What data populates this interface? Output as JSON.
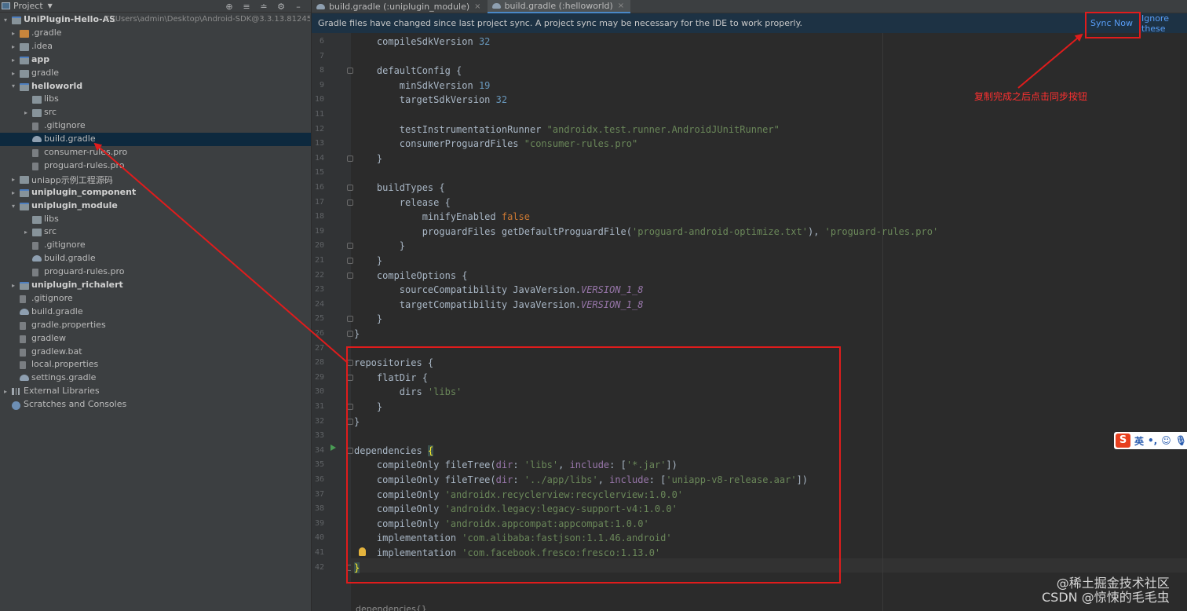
{
  "project_panel": {
    "title": "Project",
    "tree": [
      {
        "label": "UniPlugin-Hello-AS",
        "path": "C:\\Users\\admin\\Desktop\\Android-SDK@3.3.13.81245",
        "type": "module",
        "bold": true,
        "arrow": "▾",
        "level": 0
      },
      {
        "label": ".gradle",
        "type": "folder-orange",
        "arrow": "▸",
        "level": 1
      },
      {
        "label": ".idea",
        "type": "folder",
        "arrow": "▸",
        "level": 1
      },
      {
        "label": "app",
        "type": "module",
        "bold": true,
        "arrow": "▸",
        "level": 1
      },
      {
        "label": "gradle",
        "type": "folder",
        "arrow": "▸",
        "level": 1
      },
      {
        "label": "helloworld",
        "type": "module",
        "bold": true,
        "arrow": "▾",
        "level": 1
      },
      {
        "label": "libs",
        "type": "folder",
        "arrow": "",
        "level": 2
      },
      {
        "label": "src",
        "type": "folder",
        "arrow": "▸",
        "level": 2
      },
      {
        "label": ".gitignore",
        "type": "file",
        "arrow": "",
        "level": 2
      },
      {
        "label": "build.gradle",
        "type": "gradle",
        "arrow": "",
        "level": 2,
        "selected": true
      },
      {
        "label": "consumer-rules.pro",
        "type": "file",
        "arrow": "",
        "level": 2
      },
      {
        "label": "proguard-rules.pro",
        "type": "file",
        "arrow": "",
        "level": 2
      },
      {
        "label": "uniapp示例工程源码",
        "type": "folder",
        "arrow": "▸",
        "level": 1
      },
      {
        "label": "uniplugin_component",
        "type": "module",
        "bold": true,
        "arrow": "▸",
        "level": 1
      },
      {
        "label": "uniplugin_module",
        "type": "module",
        "bold": true,
        "arrow": "▾",
        "level": 1
      },
      {
        "label": "libs",
        "type": "folder",
        "arrow": "",
        "level": 2
      },
      {
        "label": "src",
        "type": "folder",
        "arrow": "▸",
        "level": 2
      },
      {
        "label": ".gitignore",
        "type": "file",
        "arrow": "",
        "level": 2
      },
      {
        "label": "build.gradle",
        "type": "gradle",
        "arrow": "",
        "level": 2
      },
      {
        "label": "proguard-rules.pro",
        "type": "file",
        "arrow": "",
        "level": 2
      },
      {
        "label": "uniplugin_richalert",
        "type": "module",
        "bold": true,
        "arrow": "▸",
        "level": 1
      },
      {
        "label": ".gitignore",
        "type": "file",
        "arrow": "",
        "level": 1
      },
      {
        "label": "build.gradle",
        "type": "gradle",
        "arrow": "",
        "level": 1
      },
      {
        "label": "gradle.properties",
        "type": "file",
        "arrow": "",
        "level": 1
      },
      {
        "label": "gradlew",
        "type": "file",
        "arrow": "",
        "level": 1
      },
      {
        "label": "gradlew.bat",
        "type": "file",
        "arrow": "",
        "level": 1
      },
      {
        "label": "local.properties",
        "type": "file",
        "arrow": "",
        "level": 1
      },
      {
        "label": "settings.gradle",
        "type": "gradle",
        "arrow": "",
        "level": 1
      },
      {
        "label": "External Libraries",
        "type": "lib",
        "arrow": "▸",
        "level": 0
      },
      {
        "label": "Scratches and Consoles",
        "type": "scratch",
        "arrow": "",
        "level": 0
      }
    ]
  },
  "tabs": [
    {
      "label": "build.gradle (:uniplugin_module)",
      "active": false
    },
    {
      "label": "build.gradle (:helloworld)",
      "active": true
    }
  ],
  "banner": {
    "message": "Gradle files have changed since last project sync. A project sync may be necessary for the IDE to work properly.",
    "sync_now": "Sync Now",
    "ignore": "Ignore these"
  },
  "editor": {
    "lines": [
      {
        "n": 6,
        "html": "    compileSdkVersion <span class=\"num\">32</span>"
      },
      {
        "n": 7,
        "html": ""
      },
      {
        "n": 8,
        "html": "    defaultConfig {",
        "fold": true
      },
      {
        "n": 9,
        "html": "        minSdkVersion <span class=\"num\">19</span>"
      },
      {
        "n": 10,
        "html": "        targetSdkVersion <span class=\"num\">32</span>"
      },
      {
        "n": 11,
        "html": ""
      },
      {
        "n": 12,
        "html": "        testInstrumentationRunner <span class=\"str\">\"androidx.test.runner.AndroidJUnitRunner\"</span>"
      },
      {
        "n": 13,
        "html": "        consumerProguardFiles <span class=\"str\">\"consumer-rules.pro\"</span>"
      },
      {
        "n": 14,
        "html": "    }",
        "fold": true
      },
      {
        "n": 15,
        "html": ""
      },
      {
        "n": 16,
        "html": "    buildTypes {",
        "fold": true
      },
      {
        "n": 17,
        "html": "        release {",
        "fold": true
      },
      {
        "n": 18,
        "html": "            minifyEnabled <span class=\"kw\">false</span>"
      },
      {
        "n": 19,
        "html": "            proguardFiles getDefaultProguardFile(<span class=\"str\">'proguard-android-optimize.txt'</span>), <span class=\"str\">'proguard-rules.pro'</span>"
      },
      {
        "n": 20,
        "html": "        }",
        "fold": true
      },
      {
        "n": 21,
        "html": "    }",
        "fold": true
      },
      {
        "n": 22,
        "html": "    compileOptions {",
        "fold": true
      },
      {
        "n": 23,
        "html": "        sourceCompatibility JavaVersion.<span class=\"param\">VERSION_1_8</span>"
      },
      {
        "n": 24,
        "html": "        targetCompatibility JavaVersion.<span class=\"param\">VERSION_1_8</span>"
      },
      {
        "n": 25,
        "html": "    }",
        "fold": true
      },
      {
        "n": 26,
        "html": "}",
        "fold": true
      },
      {
        "n": 27,
        "html": ""
      },
      {
        "n": 28,
        "html": "repositories {",
        "fold": true
      },
      {
        "n": 29,
        "html": "    flatDir {",
        "fold": true
      },
      {
        "n": 30,
        "html": "        dirs <span class=\"str\">'libs'</span>"
      },
      {
        "n": 31,
        "html": "    }",
        "fold": true
      },
      {
        "n": 32,
        "html": "}",
        "fold": true
      },
      {
        "n": 33,
        "html": ""
      },
      {
        "n": 34,
        "html": "dependencies <span class=\"hl-brace\">{</span>",
        "fold": true
      },
      {
        "n": 35,
        "html": "    compileOnly fileTree(<span class=\"named\">dir</span>: <span class=\"str\">'libs'</span>, <span class=\"named\">include</span>: [<span class=\"str\">'*.jar'</span>])"
      },
      {
        "n": 36,
        "html": "    compileOnly fileTree(<span class=\"named\">dir</span>: <span class=\"str\">'../app/libs'</span>, <span class=\"named\">include</span>: [<span class=\"str\">'uniapp-v8-release.aar'</span>])"
      },
      {
        "n": 37,
        "html": "    compileOnly <span class=\"str\">'androidx.recyclerview:recyclerview:1.0.0'</span>"
      },
      {
        "n": 38,
        "html": "    compileOnly <span class=\"str\">'androidx.legacy:legacy-support-v4:1.0.0'</span>"
      },
      {
        "n": 39,
        "html": "    compileOnly <span class=\"str\">'androidx.appcompat:appcompat:1.0.0'</span>"
      },
      {
        "n": 40,
        "html": "    implementation <span class=\"str\">'com.alibaba:fastjson:1.1.46.android'</span>"
      },
      {
        "n": 41,
        "html": "    implementation <span class=\"str\">'com.facebook.fresco:fresco:1.13.0'</span>"
      },
      {
        "n": 42,
        "html": "<span class=\"hl-brace\">}</span>",
        "fold": true
      }
    ],
    "breadcrumb": "dependencies{}"
  },
  "annotation": {
    "note": "复制完成之后点击同步按钮",
    "color": "#e01c1c"
  },
  "ime": {
    "logo": "S",
    "lang": "英",
    "punct": "•,",
    "emoji": "☺",
    "mic": "🎙"
  },
  "watermark": {
    "line1": "@稀土掘金技术社区",
    "line2": "CSDN @惊悚的毛毛虫"
  }
}
